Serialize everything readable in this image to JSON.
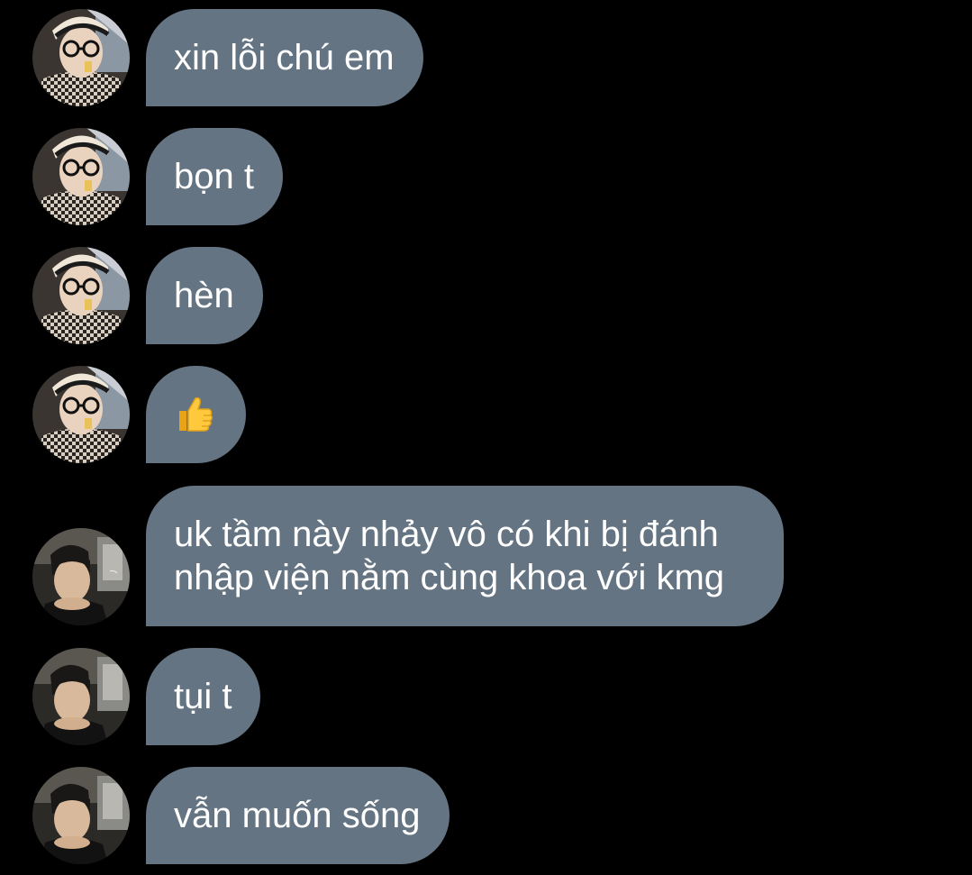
{
  "colors": {
    "background": "#000000",
    "bubble_bg": "#647482",
    "bubble_fg": "#ffffff"
  },
  "messages": [
    {
      "sender": "user-a",
      "text": "xin lỗi chú em"
    },
    {
      "sender": "user-a",
      "text": "bọn t"
    },
    {
      "sender": "user-a",
      "text": "hèn"
    },
    {
      "sender": "user-a",
      "text": "👍",
      "icon": "thumbs-up-icon"
    },
    {
      "sender": "user-b",
      "lines": [
        "uk tầm này nhảy vô có khi bị đánh",
        "nhập viện nằm cùng khoa với kmg"
      ]
    },
    {
      "sender": "user-b",
      "text": "tụi t"
    },
    {
      "sender": "user-b",
      "text": "vẫn muốn sống"
    }
  ]
}
